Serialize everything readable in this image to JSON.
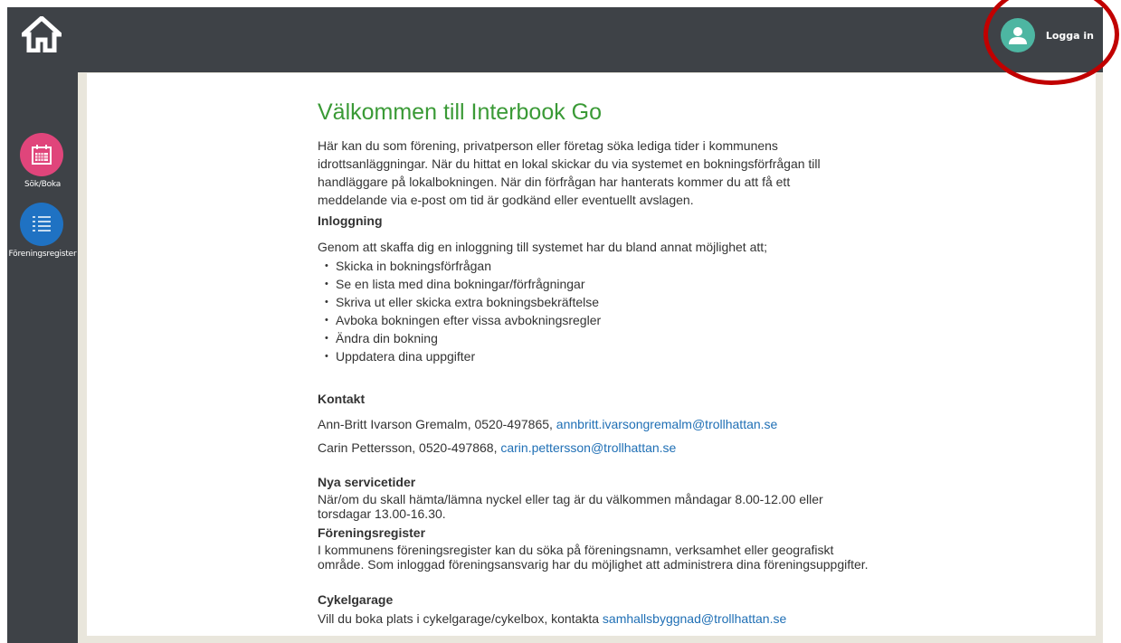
{
  "header": {
    "home_icon": "home-icon",
    "login": {
      "icon": "user-icon",
      "label": "Logga in",
      "avatar_color": "#4db6a2"
    }
  },
  "sidebar": {
    "items": [
      {
        "label": "Sök/Boka",
        "icon": "calendar-icon",
        "color": "#e0457b"
      },
      {
        "label": "Föreningsregister",
        "icon": "list-icon",
        "color": "#1f72c3"
      }
    ]
  },
  "main": {
    "title": "Välkommen till Interbook Go",
    "intro": "Här kan du som förening, privatperson eller företag söka lediga tider i kommunens idrottsanläggningar. När du hittat en lokal skickar du via systemet en bokningsförfrågan till handläggare på lokalbokningen. När din förfrågan har hanterats kommer du att få ett meddelande via e-post om tid är godkänd eller eventuellt avslagen.",
    "login_section": {
      "heading": "Inloggning",
      "intro": "Genom att skaffa dig en inloggning till systemet har du bland annat möjlighet att;",
      "items": [
        "Skicka in bokningsförfrågan",
        "Se en lista med dina bokningar/förfrågningar",
        "Skriva ut eller skicka extra bokningsbekräftelse",
        "Avboka bokningen efter vissa avbokningsregler",
        "Ändra din bokning",
        "Uppdatera dina uppgifter"
      ]
    },
    "contact": {
      "heading": "Kontakt",
      "people": [
        {
          "text": "Ann-Britt Ivarson Gremalm, 0520-497865, ",
          "email": "annbritt.ivarsongremalm@trollhattan.se"
        },
        {
          "text": "Carin Pettersson, 0520-497868, ",
          "email": "carin.pettersson@trollhattan.se"
        }
      ]
    },
    "service": {
      "heading": "Nya servicetider",
      "text": "När/om du skall hämta/lämna nyckel eller tag är du välkommen måndagar 8.00-12.00 eller torsdagar 13.00-16.30."
    },
    "registry": {
      "heading": "Föreningsregister",
      "text": "I kommunens föreningsregister kan du söka på föreningsnamn, verksamhet eller geografiskt område. Som inloggad föreningsansvarig har du möjlighet att administrera dina föreningsuppgifter."
    },
    "bike": {
      "heading": "Cykelgarage",
      "text": "Vill du boka plats i cykelgarage/cykelbox, kontakta ",
      "email": "samhallsbyggnad@trollhattan.se"
    }
  },
  "colors": {
    "frame": "#3e4247",
    "title_green": "#3a9a36",
    "link_blue": "#1f6fb5",
    "annotation_red": "#c10000"
  }
}
